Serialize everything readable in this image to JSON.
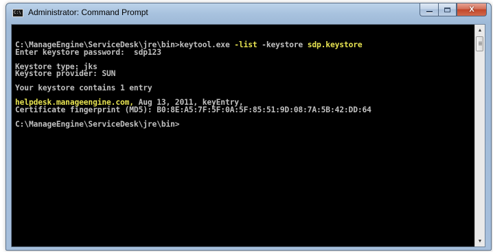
{
  "window": {
    "title": "Administrator: Command Prompt",
    "icon": "cmd-window-icon",
    "icon_label": "C:\\"
  },
  "controls": {
    "minimize_icon": "minimize-icon",
    "maximize_icon": "maximize-icon",
    "close_glyph": "X"
  },
  "console": {
    "lines": [
      {
        "segments": [
          {
            "text": "C:\\ManageEngine\\ServiceDesk\\jre\\bin>keytool.exe ",
            "hl": false
          },
          {
            "text": "-list",
            "hl": true
          },
          {
            "text": " -keystore ",
            "hl": false
          },
          {
            "text": "sdp.keystore",
            "hl": true
          }
        ]
      },
      {
        "segments": [
          {
            "text": "Enter keystore password:  sdp123",
            "hl": false
          }
        ]
      },
      {
        "segments": []
      },
      {
        "segments": [
          {
            "text": "Keystore type: jks",
            "hl": false
          }
        ]
      },
      {
        "segments": [
          {
            "text": "Keystore provider: SUN",
            "hl": false
          }
        ]
      },
      {
        "segments": []
      },
      {
        "segments": [
          {
            "text": "Your keystore contains 1 entry",
            "hl": false
          }
        ]
      },
      {
        "segments": []
      },
      {
        "segments": [
          {
            "text": "helpdesk.manageengine.com,",
            "hl": true
          },
          {
            "text": " Aug 13, 2011, keyEntry,",
            "hl": false
          }
        ]
      },
      {
        "segments": [
          {
            "text": "Certificate fingerprint (MD5): B0:8E:A5:7F:5F:0A:5F:85:51:9D:08:7A:5B:42:DD:64",
            "hl": false
          }
        ]
      },
      {
        "segments": []
      },
      {
        "segments": [
          {
            "text": "C:\\ManageEngine\\ServiceDesk\\jre\\bin>",
            "hl": false
          }
        ]
      }
    ],
    "colors": {
      "background": "#000000",
      "text": "#c0c0c0",
      "highlight": "#e6e250"
    }
  },
  "scrollbar": {
    "up_glyph": "▲",
    "down_glyph": "▼"
  }
}
